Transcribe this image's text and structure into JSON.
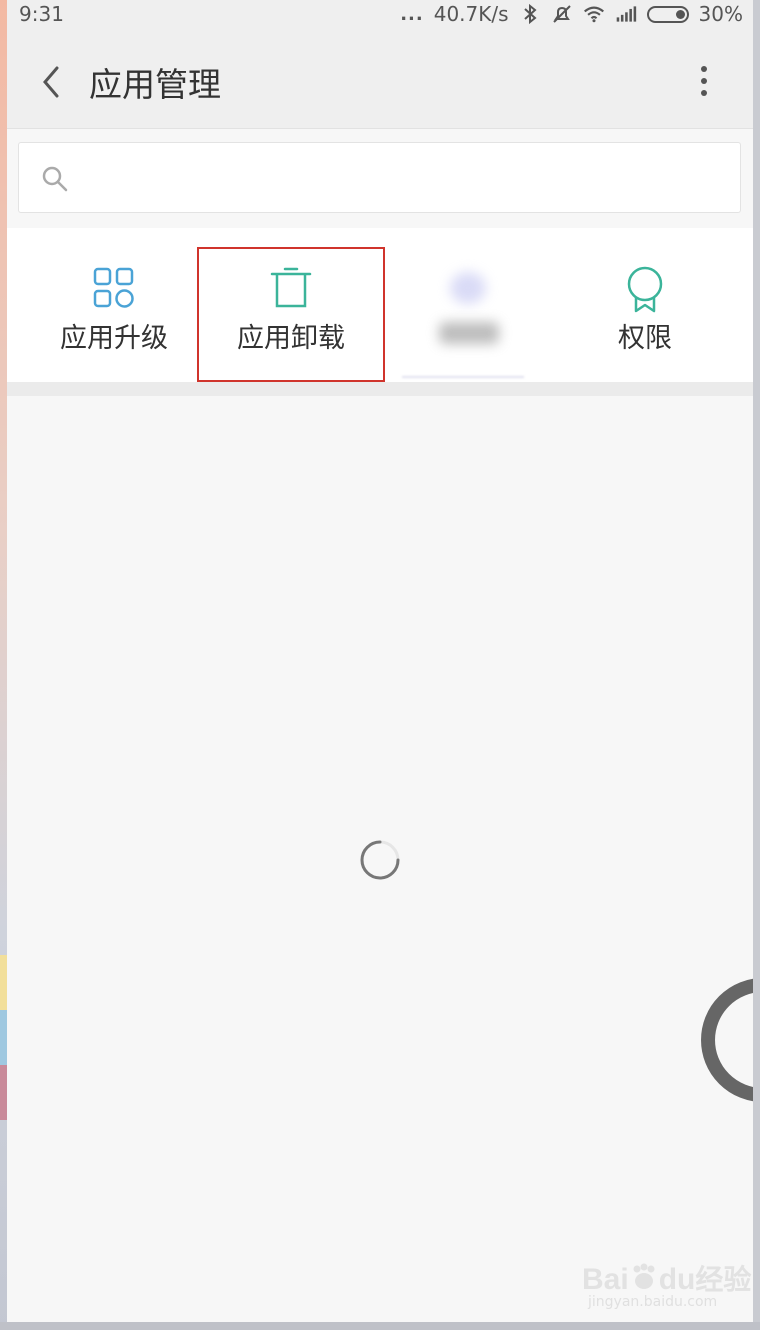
{
  "status_bar": {
    "time": "9:31",
    "dots": "...",
    "net_speed": "40.7K/s",
    "battery": "30%",
    "icons": [
      "bluetooth-icon",
      "mute-icon",
      "wifi-icon",
      "signal-icon",
      "battery-icon"
    ]
  },
  "header": {
    "title": "应用管理",
    "back_icon": "chevron-left-icon",
    "menu_icon": "more-vertical-icon"
  },
  "search": {
    "placeholder": "",
    "value": "",
    "icon": "search-icon"
  },
  "tools": [
    {
      "label": "应用升级",
      "icon": "grid-icon",
      "color": "#4aa3d6"
    },
    {
      "label": "应用卸载",
      "icon": "trash-icon",
      "color": "#3bb49a",
      "highlighted": true
    },
    {
      "label": "",
      "icon": "blurred-icon",
      "color": "#c6c8f2",
      "blurred": true
    },
    {
      "label": "权限",
      "icon": "badge-icon",
      "color": "#3bb49a"
    }
  ],
  "colors": {
    "highlight_border": "#d0342c",
    "background": "#f7f7f7"
  },
  "watermark": {
    "brand": "Bai",
    "brand2": "du",
    "suffix": "经验",
    "url": "jingyan.baidu.com"
  }
}
